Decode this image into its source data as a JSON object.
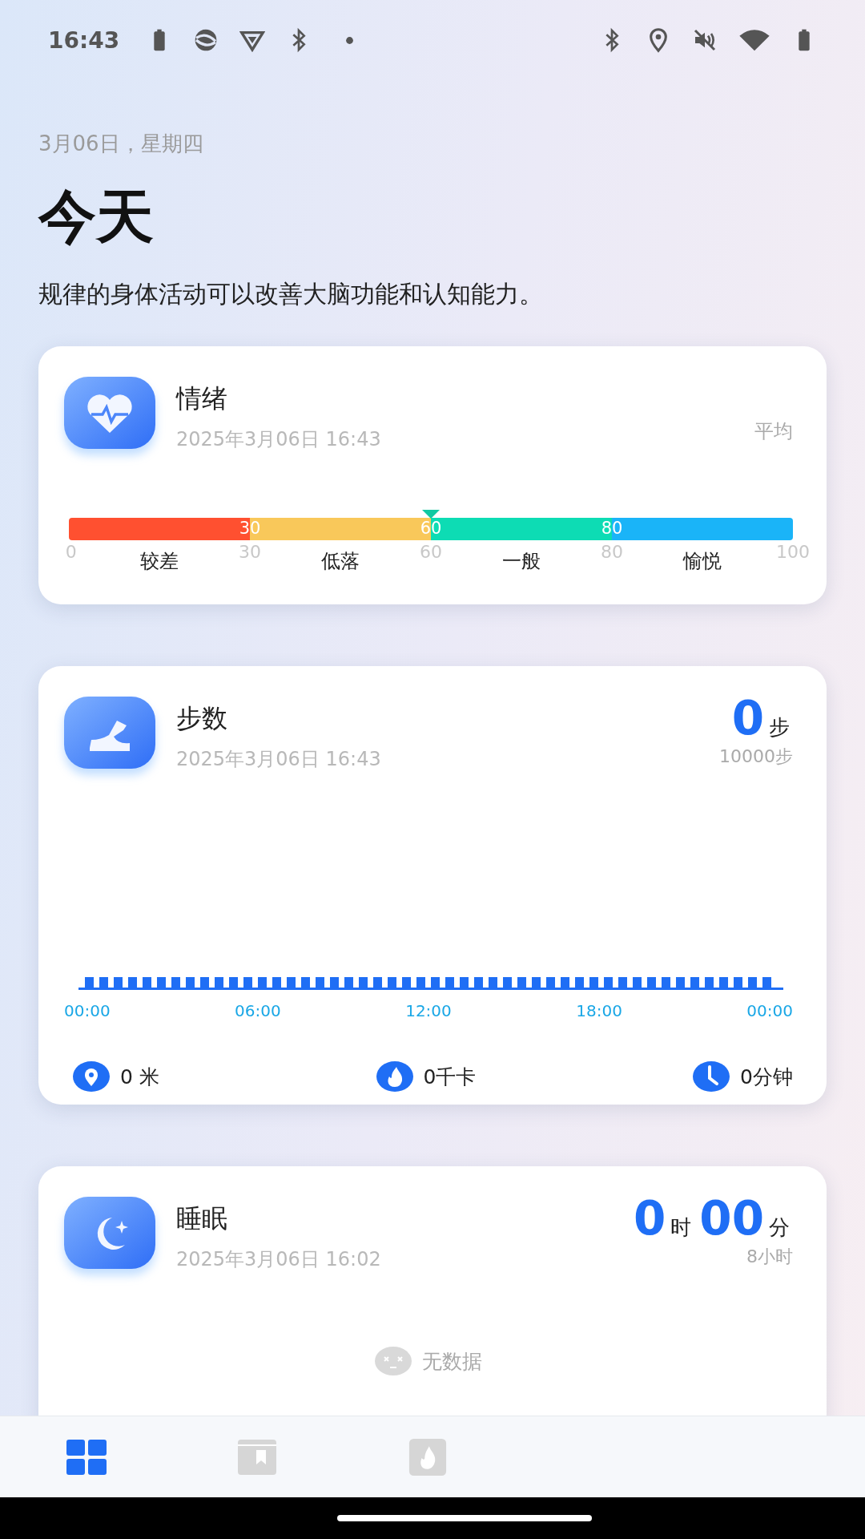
{
  "status_bar": {
    "time": "16:43"
  },
  "header": {
    "date": "3月06日，星期四",
    "title": "今天",
    "tip": "规律的身体活动可以改善大脑功能和认知能力。"
  },
  "mood_card": {
    "title": "情绪",
    "timestamp": "2025年3月06日 16:43",
    "summary": "平均",
    "level": 0.5,
    "start_tick": "0",
    "segments": [
      {
        "label": "较差",
        "color": "#ff5030",
        "bar_label": "30",
        "tick": "30"
      },
      {
        "label": "低落",
        "color": "#f9c85a",
        "bar_label": "60",
        "tick": "60"
      },
      {
        "label": "一般",
        "color": "#0ddcb4",
        "bar_label": "80",
        "tick": "80"
      },
      {
        "label": "愉悦",
        "color": "#1ab4f8",
        "tick": "100"
      }
    ]
  },
  "steps_card": {
    "title": "步数",
    "timestamp": "2025年3月06日 16:43",
    "value": "0",
    "unit": "步",
    "goal": "10000步",
    "xlabels": [
      "00:00",
      "06:00",
      "12:00",
      "18:00",
      "00:00"
    ],
    "stats": [
      {
        "kind": "distance",
        "text": "0 米"
      },
      {
        "kind": "calories",
        "text": "0千卡"
      },
      {
        "kind": "duration",
        "text": "0分钟"
      }
    ]
  },
  "sleep_card": {
    "title": "睡眠",
    "timestamp": "2025年3月06日 16:02",
    "hours": "0",
    "hours_unit": "时",
    "minutes": "00",
    "minutes_unit": "分",
    "goal": "8小时",
    "empty_text": "无数据"
  },
  "nav": [
    {
      "kind": "dashboard",
      "selected": true
    },
    {
      "kind": "book",
      "selected": false
    },
    {
      "kind": "flame",
      "selected": false
    }
  ]
}
